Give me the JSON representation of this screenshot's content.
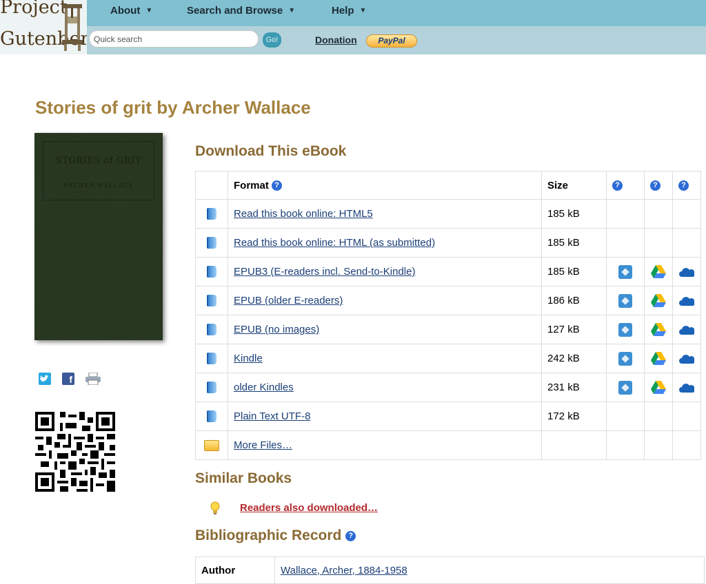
{
  "header": {
    "logo_line1": "Project",
    "logo_line2": "Gutenberg",
    "nav": [
      {
        "label": "About"
      },
      {
        "label": "Search and Browse"
      },
      {
        "label": "Help"
      }
    ],
    "search": {
      "placeholder": "Quick search",
      "go_label": "Go!"
    },
    "donation_label": "Donation",
    "paypal_label": "PayPal"
  },
  "book": {
    "page_title": "Stories of grit by Archer Wallace",
    "cover_title": "STORIES of GRIT",
    "cover_author": "ARCHER WALLACE"
  },
  "download": {
    "heading": "Download This eBook",
    "columns": {
      "format": "Format",
      "size": "Size",
      "help_glyph": "?"
    },
    "rows": [
      {
        "format": "Read this book online: HTML5",
        "size": "185 kB",
        "cloud": false
      },
      {
        "format": "Read this book online: HTML (as submitted)",
        "size": "185 kB",
        "cloud": false
      },
      {
        "format": "EPUB3 (E-readers incl. Send-to-Kindle)",
        "size": "185 kB",
        "cloud": true
      },
      {
        "format": "EPUB (older E-readers)",
        "size": "186 kB",
        "cloud": true
      },
      {
        "format": "EPUB (no images)",
        "size": "127 kB",
        "cloud": true
      },
      {
        "format": "Kindle",
        "size": "242 kB",
        "cloud": true
      },
      {
        "format": "older Kindles",
        "size": "231 kB",
        "cloud": true
      },
      {
        "format": "Plain Text UTF-8",
        "size": "172 kB",
        "cloud": false
      },
      {
        "format": "More Files…",
        "size": "",
        "cloud": false,
        "folder": true
      }
    ]
  },
  "similar": {
    "heading": "Similar Books",
    "link": "Readers also downloaded…"
  },
  "bibliographic": {
    "heading": "Bibliographic Record",
    "rows": [
      {
        "key": "Author",
        "value": "Wallace, Archer, 1884-1958"
      }
    ]
  }
}
